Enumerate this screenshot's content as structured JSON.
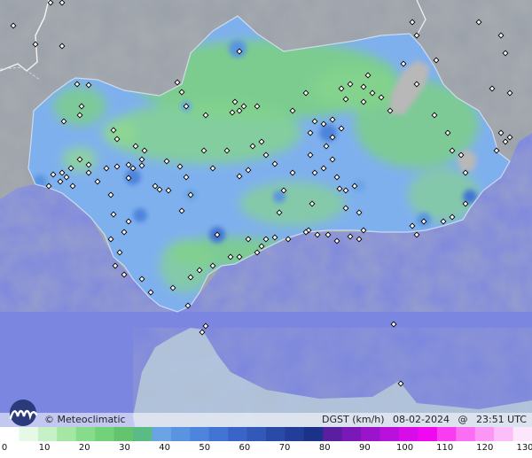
{
  "brand": {
    "copyright": "©",
    "name": "Meteoclimatic"
  },
  "map_info": {
    "variable": "DGST (km/h)",
    "date": "08-02-2024",
    "at": "@",
    "time": "23:51 UTC"
  },
  "colors": {
    "sea": "#7b86e0",
    "land_outside": "#9aa0a8",
    "region_base": "#7fb0ee",
    "region_green": "#7ccf86",
    "grey_patch": "#b8b8b8",
    "station_marker": "#ffffff"
  },
  "scale": {
    "ticks": [
      "0",
      "10",
      "20",
      "30",
      "40",
      "50",
      "60",
      "70",
      "80",
      "90",
      "100",
      "110",
      "120",
      "130"
    ],
    "colors": [
      "#ffffff",
      "#e6f9e6",
      "#c6f0c6",
      "#a4e6a4",
      "#86dc8a",
      "#72d27a",
      "#64c46e",
      "#5abc84",
      "#6aa4e4",
      "#5a94e0",
      "#4e84dc",
      "#4274d4",
      "#3a64c8",
      "#3258b8",
      "#2a4aa8",
      "#223e98",
      "#1a3288",
      "#5a1ea0",
      "#7a18b8",
      "#9a14cc",
      "#ba10dc",
      "#d80ce8",
      "#f008f0",
      "#f83cf0",
      "#fa6ef4",
      "#fb96f6",
      "#fcbef8",
      "#fde6fb"
    ]
  },
  "stations": [
    [
      15,
      29
    ],
    [
      57,
      3
    ],
    [
      70,
      3
    ],
    [
      40,
      50
    ],
    [
      70,
      52
    ],
    [
      87,
      95
    ],
    [
      100,
      96
    ],
    [
      92,
      120
    ],
    [
      72,
      137
    ],
    [
      90,
      130
    ],
    [
      128,
      147
    ],
    [
      132,
      157
    ],
    [
      153,
      165
    ],
    [
      163,
      170
    ],
    [
      160,
      180
    ],
    [
      145,
      186
    ],
    [
      145,
      201
    ],
    [
      132,
      188
    ],
    [
      120,
      190
    ],
    [
      100,
      186
    ],
    [
      90,
      180
    ],
    [
      80,
      190
    ],
    [
      70,
      195
    ],
    [
      60,
      197
    ],
    [
      55,
      210
    ],
    [
      75,
      200
    ],
    [
      68,
      205
    ],
    [
      82,
      210
    ],
    [
      100,
      195
    ],
    [
      110,
      205
    ],
    [
      125,
      220
    ],
    [
      150,
      190
    ],
    [
      160,
      187
    ],
    [
      188,
      182
    ],
    [
      203,
      188
    ],
    [
      175,
      210
    ],
    [
      180,
      214
    ],
    [
      190,
      215
    ],
    [
      210,
      200
    ],
    [
      215,
      220
    ],
    [
      205,
      238
    ],
    [
      230,
      170
    ],
    [
      232,
      130
    ],
    [
      200,
      93
    ],
    [
      205,
      104
    ],
    [
      210,
      120
    ],
    [
      270,
      58
    ],
    [
      265,
      115
    ],
    [
      275,
      120
    ],
    [
      270,
      125
    ],
    [
      262,
      127
    ],
    [
      290,
      120
    ],
    [
      285,
      165
    ],
    [
      300,
      175
    ],
    [
      295,
      160
    ],
    [
      310,
      185
    ],
    [
      320,
      215
    ],
    [
      315,
      240
    ],
    [
      280,
      192
    ],
    [
      270,
      199
    ],
    [
      256,
      170
    ],
    [
      240,
      190
    ],
    [
      330,
      125
    ],
    [
      345,
      105
    ],
    [
      350,
      150
    ],
    [
      355,
      137
    ],
    [
      365,
      140
    ],
    [
      375,
      135
    ],
    [
      375,
      155
    ],
    [
      385,
      145
    ],
    [
      368,
      165
    ],
    [
      375,
      180
    ],
    [
      380,
      200
    ],
    [
      383,
      213
    ],
    [
      390,
      215
    ],
    [
      400,
      210
    ],
    [
      405,
      240
    ],
    [
      390,
      235
    ],
    [
      365,
      190
    ],
    [
      355,
      195
    ],
    [
      350,
      175
    ],
    [
      330,
      195
    ],
    [
      352,
      230
    ],
    [
      348,
      260
    ],
    [
      358,
      265
    ],
    [
      345,
      262
    ],
    [
      370,
      265
    ],
    [
      380,
      272
    ],
    [
      395,
      267
    ],
    [
      405,
      270
    ],
    [
      325,
      270
    ],
    [
      310,
      268
    ],
    [
      300,
      270
    ],
    [
      295,
      278
    ],
    [
      290,
      285
    ],
    [
      270,
      290
    ],
    [
      260,
      290
    ],
    [
      240,
      300
    ],
    [
      225,
      305
    ],
    [
      215,
      313
    ],
    [
      212,
      345
    ],
    [
      195,
      325
    ],
    [
      170,
      330
    ],
    [
      160,
      315
    ],
    [
      140,
      310
    ],
    [
      130,
      300
    ],
    [
      135,
      285
    ],
    [
      125,
      270
    ],
    [
      140,
      262
    ],
    [
      145,
      250
    ],
    [
      128,
      242
    ],
    [
      245,
      265
    ],
    [
      280,
      270
    ],
    [
      410,
      98
    ],
    [
      415,
      85
    ],
    [
      410,
      115
    ],
    [
      420,
      105
    ],
    [
      430,
      110
    ],
    [
      395,
      95
    ],
    [
      390,
      112
    ],
    [
      385,
      100
    ],
    [
      440,
      125
    ],
    [
      490,
      130
    ],
    [
      505,
      150
    ],
    [
      510,
      170
    ],
    [
      520,
      175
    ],
    [
      525,
      195
    ],
    [
      525,
      230
    ],
    [
      510,
      245
    ],
    [
      500,
      250
    ],
    [
      478,
      250
    ],
    [
      465,
      255
    ],
    [
      470,
      265
    ],
    [
      410,
      260
    ],
    [
      455,
      72
    ],
    [
      470,
      95
    ],
    [
      492,
      68
    ],
    [
      465,
      25
    ],
    [
      470,
      40
    ],
    [
      540,
      25
    ],
    [
      565,
      40
    ],
    [
      570,
      60
    ],
    [
      555,
      100
    ],
    [
      575,
      105
    ],
    [
      565,
      150
    ],
    [
      570,
      160
    ],
    [
      575,
      155
    ],
    [
      560,
      170
    ],
    [
      232,
      368
    ],
    [
      228,
      375
    ],
    [
      452,
      433
    ],
    [
      444,
      366
    ]
  ]
}
